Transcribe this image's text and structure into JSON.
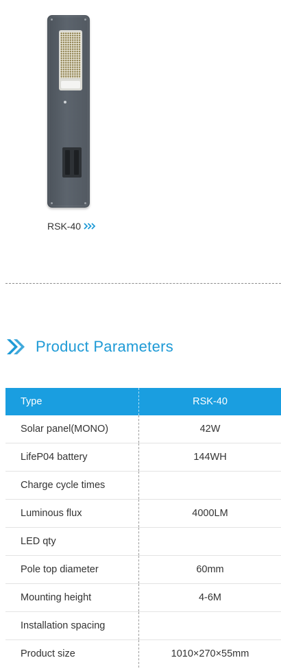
{
  "product": {
    "model_link_label": "RSK-40",
    "image_name": "solar street light RSK-40"
  },
  "section": {
    "title": "Product Parameters"
  },
  "colors": {
    "accent": "#1a9ee0",
    "title_blue": "#1e9ad6",
    "text": "#333333"
  },
  "params_table": {
    "header": {
      "label": "Type",
      "value": "RSK-40"
    },
    "rows": [
      {
        "label": "Solar panel(MONO)",
        "value": "42W"
      },
      {
        "label": "LifeP04 battery",
        "value": "144WH"
      },
      {
        "label": "Charge cycle times",
        "value": ""
      },
      {
        "label": "Luminous flux",
        "value": "4000LM"
      },
      {
        "label": "LED qty",
        "value": ""
      },
      {
        "label": "Pole top diameter",
        "value": "60mm"
      },
      {
        "label": "Mounting height",
        "value": "4-6M"
      },
      {
        "label": "Installation spacing",
        "value": ""
      },
      {
        "label": "Product size",
        "value": "1010×270×55mm"
      }
    ]
  }
}
